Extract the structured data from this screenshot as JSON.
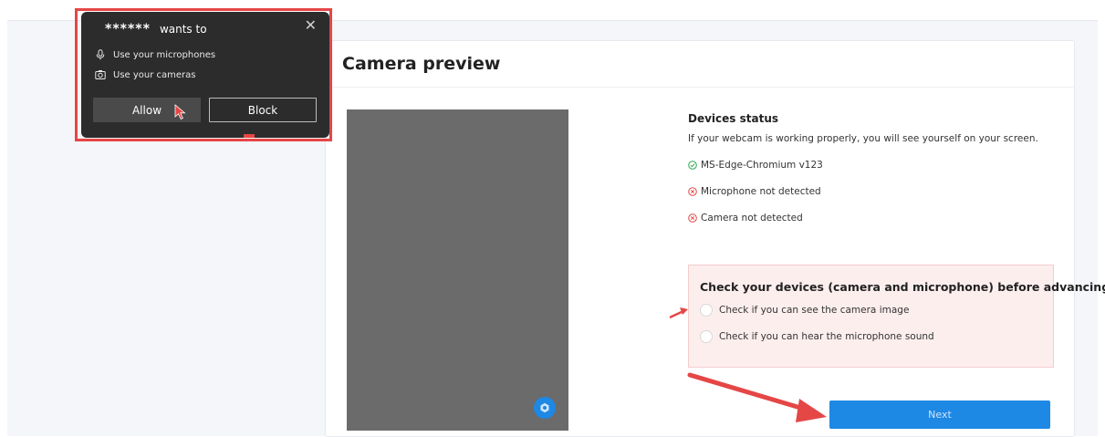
{
  "card": {
    "title": "Camera preview"
  },
  "devices_status": {
    "heading": "Devices status",
    "description": "If your webcam is working properly, you will see yourself on your screen.",
    "items": [
      {
        "label": "MS-Edge-Chromium v123",
        "state": "ok",
        "icon": "check-circle-icon"
      },
      {
        "label": "Microphone not detected",
        "state": "error",
        "icon": "error-circle-icon"
      },
      {
        "label": "Camera not detected",
        "state": "error",
        "icon": "error-circle-icon"
      }
    ]
  },
  "checks": {
    "heading": "Check your devices (camera and microphone) before advancing",
    "camera_label": "Check if you can see the camera image",
    "microphone_label": "Check if you can hear the microphone sound"
  },
  "next_label": "Next",
  "permission_prompt": {
    "site": "******",
    "wants_to": "wants to",
    "mic_label": "Use your microphones",
    "camera_label": "Use your cameras",
    "allow_label": "Allow",
    "block_label": "Block",
    "close_icon": "close-icon"
  },
  "colors": {
    "accent": "#1e88e5",
    "ok": "#2fa84f",
    "error": "#e04848",
    "annotation": "#e54646",
    "prompt_bg": "#2c2c2c"
  }
}
